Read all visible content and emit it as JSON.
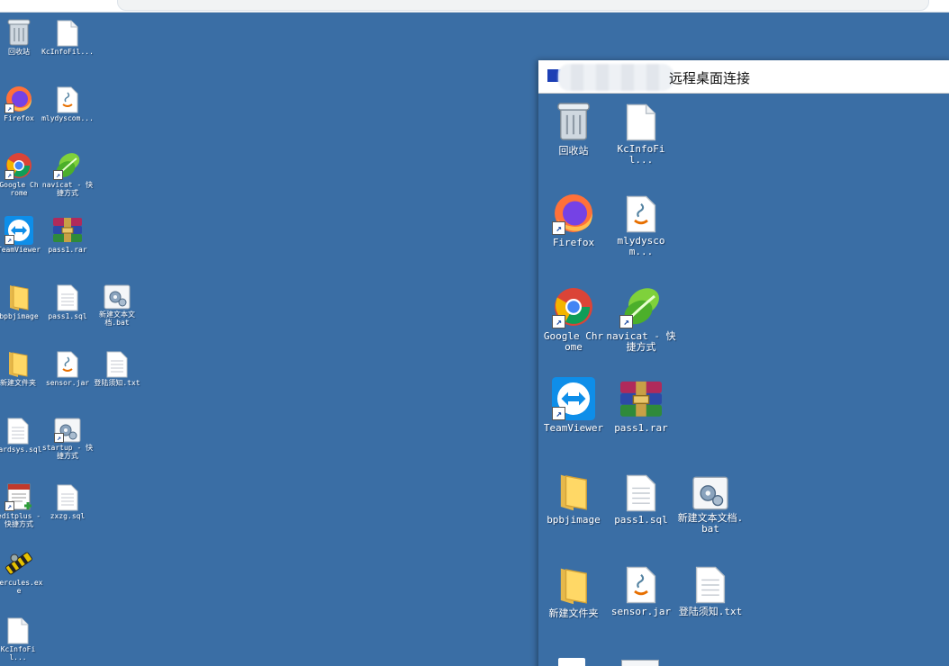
{
  "left_desktop": {
    "icons": [
      {
        "label": "回收站",
        "icon": "recycle-bin-icon"
      },
      {
        "label": "KcInfoFil...",
        "icon": "blank-file-icon"
      },
      {
        "label": "Firefox",
        "icon": "firefox-icon"
      },
      {
        "label": "mlydyscom...",
        "icon": "java-file-icon"
      },
      {
        "label": "Google Chrome",
        "icon": "chrome-icon"
      },
      {
        "label": "navicat - 快捷方式",
        "icon": "navicat-icon"
      },
      {
        "label": "TeamViewer",
        "icon": "teamviewer-icon"
      },
      {
        "label": "pass1.rar",
        "icon": "winrar-icon"
      },
      {
        "label": "bpbjimage",
        "icon": "folder-icon"
      },
      {
        "label": "pass1.sql",
        "icon": "text-file-icon"
      },
      {
        "label": "新建文本文档.bat",
        "icon": "bat-file-icon"
      },
      {
        "label": "新建文件夹",
        "icon": "folder-icon"
      },
      {
        "label": "sensor.jar",
        "icon": "java-file-icon"
      },
      {
        "label": "登陆须知.txt",
        "icon": "text-file-icon"
      },
      {
        "label": "cardsys.sql",
        "icon": "text-file-icon"
      },
      {
        "label": "startup - 快捷方式",
        "icon": "bat-file-icon"
      },
      {
        "label": "editplus - 快捷方式",
        "icon": "editplus-icon"
      },
      {
        "label": "zxzg.sql",
        "icon": "text-file-icon"
      },
      {
        "label": "hercules.exe",
        "icon": "hercules-icon"
      },
      {
        "label": "KcInfoFil...",
        "icon": "blank-file-icon"
      }
    ]
  },
  "remote_window": {
    "title": "远程桌面连接",
    "icons": [
      {
        "label": "回收站",
        "icon": "recycle-bin-icon"
      },
      {
        "label": "KcInfoFil...",
        "icon": "blank-file-icon"
      },
      {
        "label": "Firefox",
        "icon": "firefox-icon"
      },
      {
        "label": "mlydyscom...",
        "icon": "java-file-icon"
      },
      {
        "label": "Google Chrome",
        "icon": "chrome-icon"
      },
      {
        "label": "navicat - 快捷方式",
        "icon": "navicat-icon"
      },
      {
        "label": "TeamViewer",
        "icon": "teamviewer-icon"
      },
      {
        "label": "pass1.rar",
        "icon": "winrar-icon"
      },
      {
        "label": "bpbjimage",
        "icon": "folder-icon"
      },
      {
        "label": "pass1.sql",
        "icon": "text-file-icon"
      },
      {
        "label": "新建文本文档.bat",
        "icon": "bat-file-icon"
      },
      {
        "label": "新建文件夹",
        "icon": "folder-icon"
      },
      {
        "label": "sensor.jar",
        "icon": "java-file-icon"
      },
      {
        "label": "登陆须知.txt",
        "icon": "text-file-icon"
      }
    ]
  },
  "colors": {
    "desktop": "#3a6ea5",
    "title_bar": "#ffffff"
  }
}
